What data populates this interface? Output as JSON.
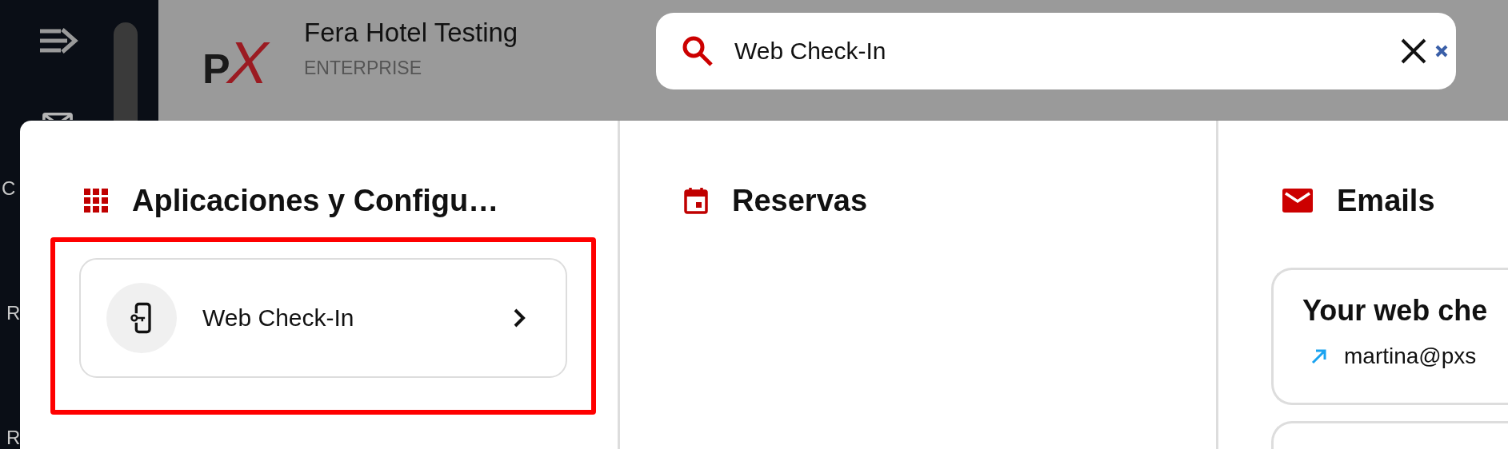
{
  "sidebar": {
    "items": [
      {
        "label": "C"
      },
      {
        "label": "R"
      },
      {
        "label": "R"
      }
    ]
  },
  "header": {
    "logo": [
      "P",
      "X"
    ],
    "title": "Fera Hotel Testing",
    "subtitle": "ENTERPRISE"
  },
  "search": {
    "value": "Web Check-In"
  },
  "columns": [
    {
      "kind": "apps",
      "title": "Aplicaciones y Configu…",
      "items": [
        {
          "label": "Web Check-In",
          "highlighted": true
        }
      ]
    },
    {
      "kind": "bookings",
      "title": "Reservas"
    },
    {
      "kind": "emails",
      "title": "Emails",
      "emails": [
        {
          "kind": "full",
          "subject": "Your web che",
          "to": "martina@pxs"
        },
        {
          "kind": "partial"
        }
      ]
    }
  ]
}
